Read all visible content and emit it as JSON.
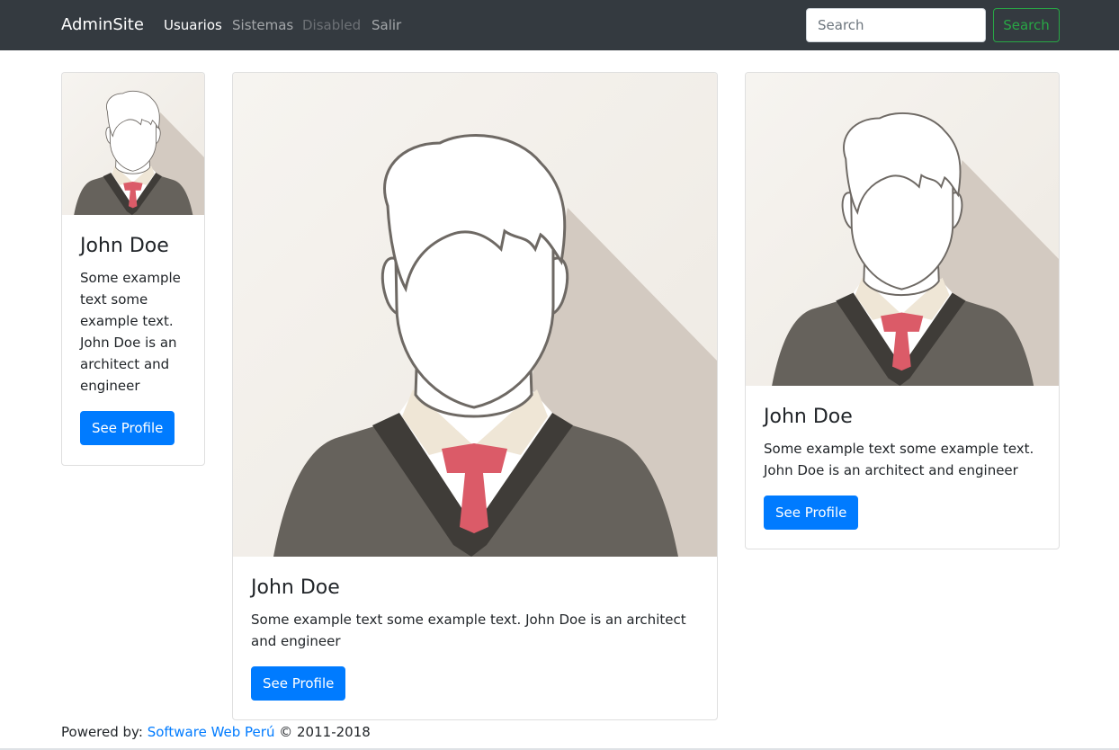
{
  "navbar": {
    "brand": "AdminSite",
    "links": [
      {
        "label": "Usuarios",
        "state": "active"
      },
      {
        "label": "Sistemas",
        "state": "normal"
      },
      {
        "label": "Disabled",
        "state": "disabled"
      },
      {
        "label": "Salir",
        "state": "normal"
      }
    ],
    "search": {
      "placeholder": "Search",
      "button_label": "Search"
    }
  },
  "cards": [
    {
      "title": "John Doe",
      "text": "Some example text some example text. John Doe is an architect and engineer",
      "button_label": "See Profile",
      "image": "avatar-image"
    },
    {
      "title": "John Doe",
      "text": "Some example text some example text. John Doe is an architect and engineer",
      "button_label": "See Profile",
      "image": "avatar-image"
    },
    {
      "title": "John Doe",
      "text": "Some example text some example text. John Doe is an architect and engineer",
      "button_label": "See Profile",
      "image": "avatar-image"
    }
  ],
  "footer": {
    "prefix": "Powered by:",
    "link_text": "Software Web Perú",
    "suffix": "© 2011-2018"
  },
  "colors": {
    "navbar_bg": "#343a40",
    "primary": "#007bff",
    "success": "#28a745",
    "avatar_bg": "#f3f0eb",
    "avatar_shadow": "#d3cac1",
    "sweater": "#66625c",
    "tie": "#db5b68"
  }
}
